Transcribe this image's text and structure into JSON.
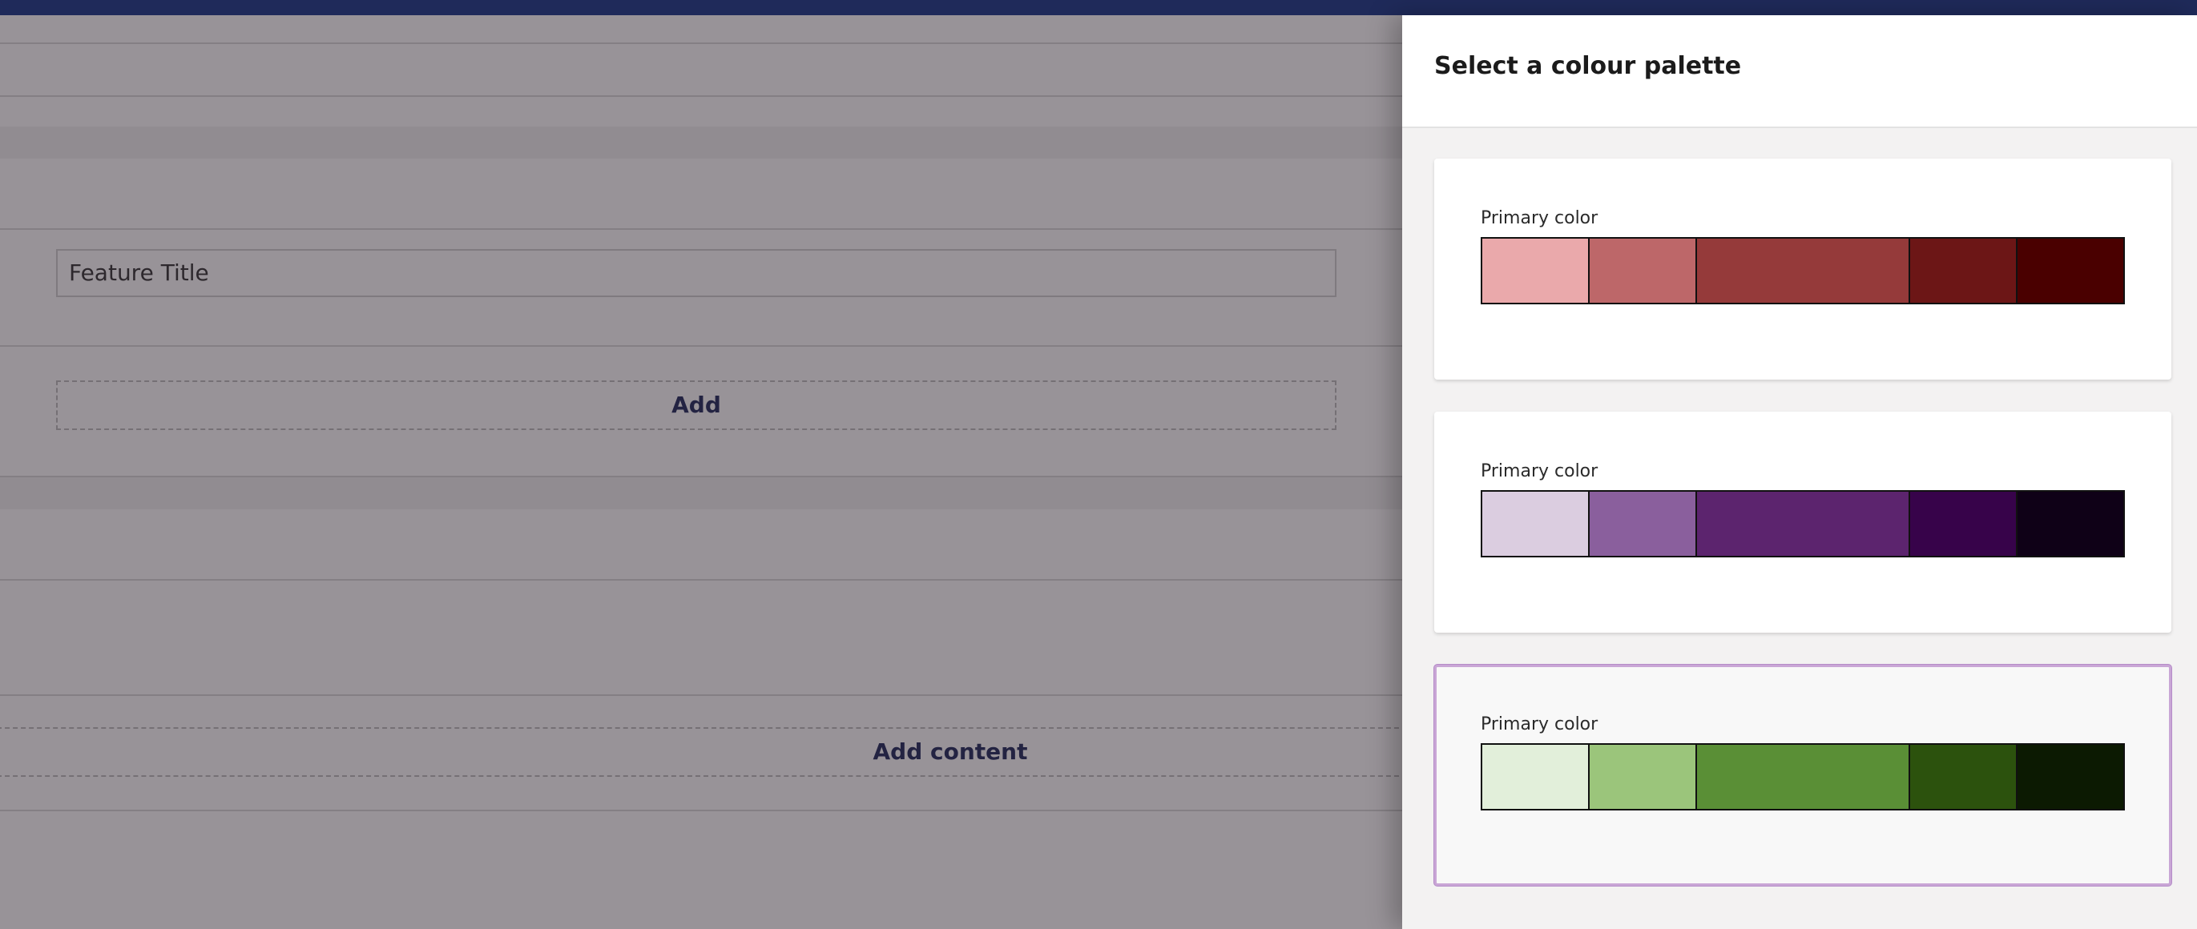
{
  "editor": {
    "feature_title_value": "Feature Title",
    "add_label": "Add",
    "add_content_label": "Add content"
  },
  "panel": {
    "title": "Select a colour palette",
    "palettes": [
      {
        "label": "Primary color",
        "selected": false,
        "colors": [
          "#eaa9ab",
          "#bd6769",
          "#953a3a",
          "#6c1616",
          "#4a0000"
        ]
      },
      {
        "label": "Primary color",
        "selected": false,
        "colors": [
          "#dbcde0",
          "#8a5f9d",
          "#5c246e",
          "#37034a",
          "#0f0117"
        ]
      },
      {
        "label": "Primary color",
        "selected": true,
        "colors": [
          "#e2efda",
          "#9bc57b",
          "#5a8f36",
          "#2c520d",
          "#0c1a02"
        ]
      }
    ]
  },
  "colors": {
    "topbar": "#1f2a5a",
    "accent_text": "#1f2a5a",
    "selected_border": "#c9a6d6"
  }
}
